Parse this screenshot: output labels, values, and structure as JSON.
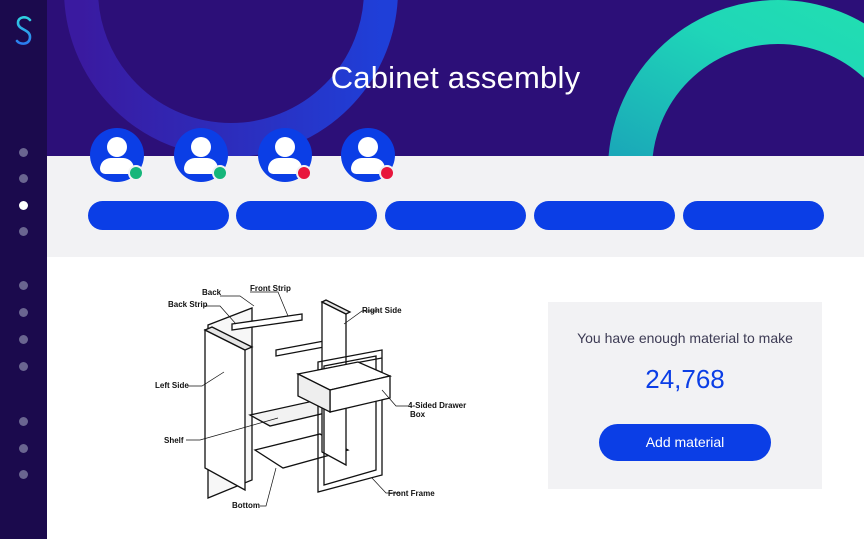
{
  "app": {
    "logo_letter": "S",
    "title": "Cabinet assembly"
  },
  "sidebar": {
    "active_index": 2,
    "dot_count": 11
  },
  "team": {
    "members": [
      {
        "status": "online"
      },
      {
        "status": "online"
      },
      {
        "status": "busy"
      },
      {
        "status": "busy"
      }
    ]
  },
  "diagram": {
    "labels": {
      "back": "Back",
      "back_strip": "Back Strip",
      "front_strip": "Front Strip",
      "right_side": "Right Side",
      "left_side": "Left Side",
      "drawer_line1": "4-Sided Drawer",
      "drawer_line2": "Box",
      "shelf": "Shelf",
      "bottom": "Bottom",
      "front_frame": "Front Frame"
    }
  },
  "card": {
    "label": "You have enough material to make",
    "count": "24,768",
    "button_label": "Add material"
  },
  "colors": {
    "sidebar": "#1b0a4d",
    "header": "#2c0f78",
    "accent": "#0b3ee6",
    "online": "#16b67a",
    "busy": "#e8163c"
  }
}
